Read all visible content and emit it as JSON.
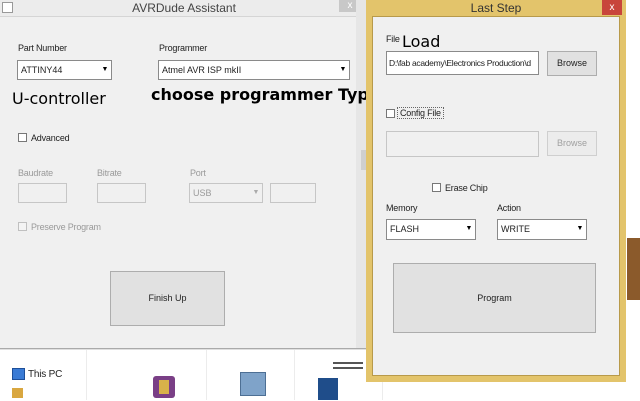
{
  "main_window": {
    "title": "AVRDude Assistant",
    "close": "x",
    "part_number": {
      "label": "Part Number",
      "value": "ATTINY44"
    },
    "programmer": {
      "label": "Programmer",
      "value": "Atmel AVR ISP mkII"
    },
    "advanced_label": "Advanced",
    "baudrate_label": "Baudrate",
    "bitrate_label": "Bitrate",
    "port": {
      "label": "Port",
      "value": "USB"
    },
    "preserve_label": "Preserve Program",
    "finish_label": "Finish Up"
  },
  "annotations": {
    "controller": "U-controller",
    "programmer": "choose programmer Type",
    "load": "Load"
  },
  "last_window": {
    "title": "Last Step",
    "close": "x",
    "file": {
      "label": "File",
      "value": "D:\\fab academy\\Electronics Production\\d"
    },
    "browse_label": "Browse",
    "config_label": "Config File",
    "browse2_label": "Browse",
    "erase_label": "Erase Chip",
    "memory": {
      "label": "Memory",
      "value": "FLASH"
    },
    "action": {
      "label": "Action",
      "value": "WRITE"
    },
    "program_label": "Program"
  },
  "explorer": {
    "this_pc": "This PC"
  },
  "icons": {
    "dropdown": "▼",
    "main_close": "close-icon",
    "last_close": "close-icon"
  }
}
